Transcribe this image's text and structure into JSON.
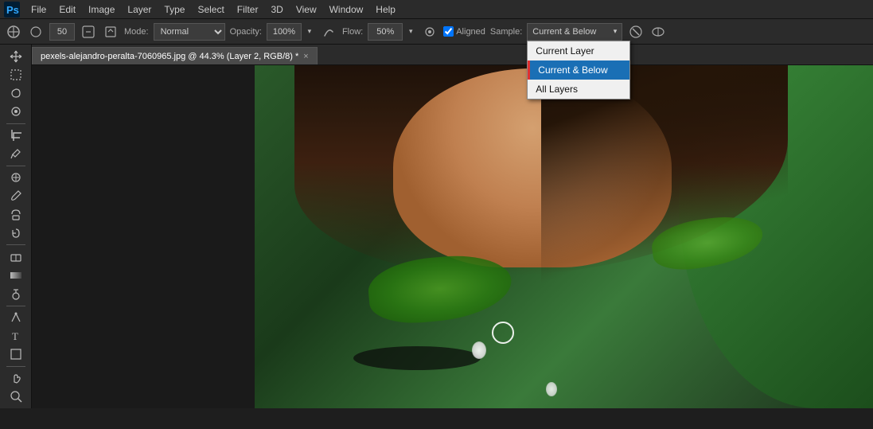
{
  "app": {
    "title": "Adobe Photoshop",
    "logo": "Ps"
  },
  "menubar": {
    "items": [
      "File",
      "Edit",
      "Image",
      "Layer",
      "Type",
      "Select",
      "Filter",
      "3D",
      "View",
      "Window",
      "Help"
    ]
  },
  "toolbar": {
    "mode_label": "Mode:",
    "mode_value": "Normal",
    "opacity_label": "Opacity:",
    "opacity_value": "100%",
    "flow_label": "Flow:",
    "flow_value": "50%",
    "aligned_label": "Aligned",
    "sample_label": "Sample:",
    "sample_value": "Current & Below",
    "brush_size": "50"
  },
  "sample_dropdown": {
    "options": [
      {
        "label": "Current Layer",
        "selected": false
      },
      {
        "label": "Current & Below",
        "selected": true
      },
      {
        "label": "All Layers",
        "selected": false
      }
    ]
  },
  "tab": {
    "filename": "pexels-alejandro-peralta-7060965.jpg @ 44.3% (Layer 2, RGB/8) *",
    "close_label": "×"
  },
  "tools": [
    "move",
    "marquee",
    "lasso",
    "quick-select",
    "crop",
    "eyedropper",
    "healing-brush",
    "brush",
    "clone-stamp",
    "history-brush",
    "eraser",
    "gradient",
    "dodge",
    "pen",
    "type",
    "path-select",
    "shape",
    "hand",
    "zoom"
  ]
}
